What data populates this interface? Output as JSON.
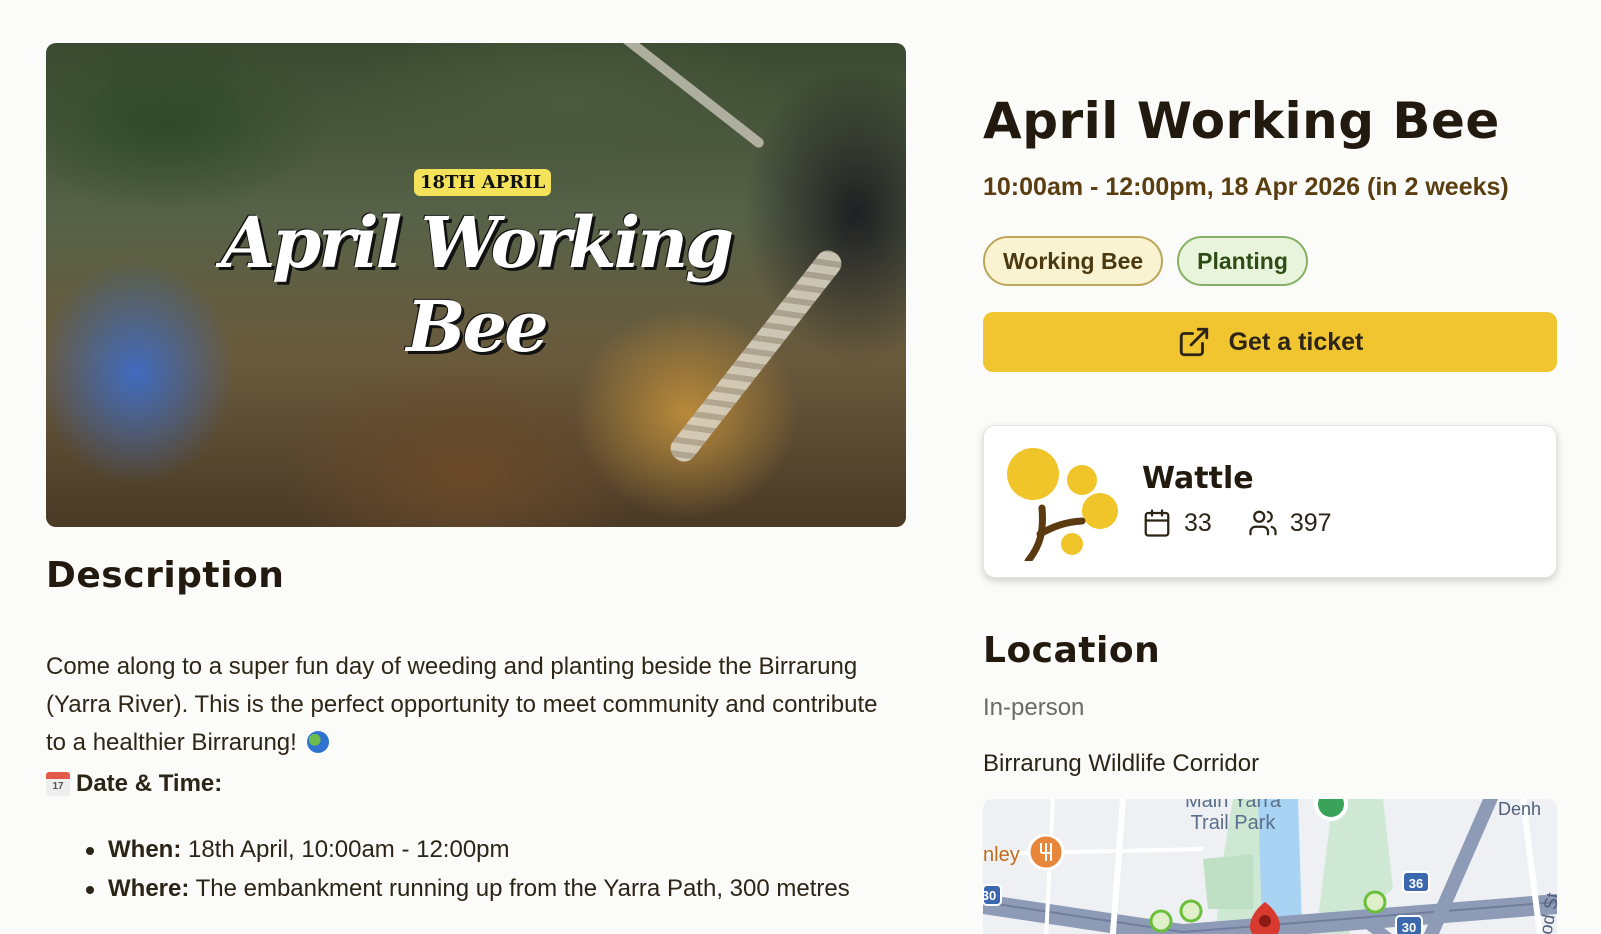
{
  "hero": {
    "badge": "18TH APRIL",
    "title_line1": "April Working",
    "title_line2": "Bee"
  },
  "description": {
    "heading": "Description",
    "body": "Come along to a super fun day of weeding and planting beside the Birrarung (Yarra River). This is the perfect opportunity to meet community and contribute to a healthier Birrarung!",
    "datetime_heading": "Date & Time:",
    "calendar_emoji_day": "17",
    "items": [
      {
        "label": "When:",
        "value": "18th April, 10:00am - 12:00pm"
      },
      {
        "label": "Where:",
        "value": "The embankment running up from the Yarra Path, 300 metres"
      }
    ]
  },
  "event": {
    "title": "April Working Bee",
    "datetime": "10:00am - 12:00pm, 18 Apr 2026 (in 2 weeks)",
    "tags": [
      "Working Bee",
      "Planting"
    ],
    "ticket_label": "Get a ticket"
  },
  "organizer": {
    "name": "Wattle",
    "events_count": "33",
    "followers_count": "397"
  },
  "location": {
    "heading": "Location",
    "type": "In-person",
    "name": "Birrarung Wildlife Corridor",
    "map_labels": {
      "park": "Main Yarra Trail Park",
      "restaurant": "nley",
      "street_right": "Denh",
      "street_vertical": "lood St",
      "street_left": "St",
      "route_36": "36",
      "route_30": "30",
      "route_30b": "30"
    }
  },
  "colors": {
    "accent": "#f1c52f",
    "title": "#221a0e",
    "datetime": "#5a3e10",
    "wattle_yellow": "#f0c52a",
    "wattle_brown": "#5b3a12"
  }
}
